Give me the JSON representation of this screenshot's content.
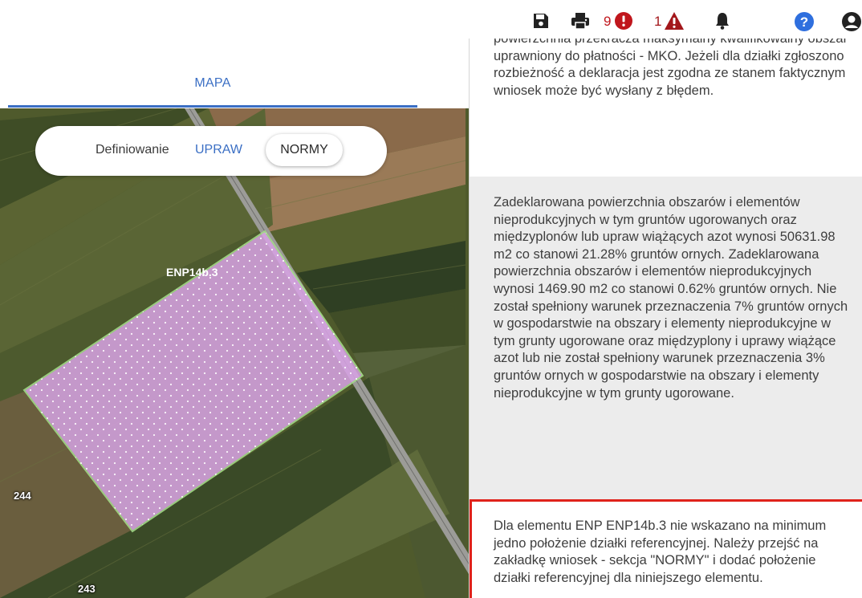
{
  "map": {
    "tab_label": "MAPA",
    "definition": {
      "label": "Definiowanie",
      "upraw": "UPRAW",
      "normy": "NORMY"
    },
    "parcel_label": "ENP14b.3",
    "parcel_numbers": [
      "244",
      "243"
    ]
  },
  "toolbar": {
    "icons": [
      "save-icon",
      "print-icon",
      "error-icon",
      "warning-icon",
      "bell-icon",
      "help-icon",
      "user-icon"
    ],
    "error_count": "9",
    "warning_count": "1"
  },
  "messages": [
    {
      "text": "powierzchnia przekracza maksymalny kwalifikowalny obszar uprawniony do płatności - MKO. Jeżeli dla działki zgłoszono rozbieżność a deklaracja jest zgodna ze stanem faktycznym wniosek może być wysłany z błędem."
    },
    {
      "text": "Zadeklarowana powierzchnia obszarów i elementów nieprodukcyjnych w tym gruntów ugorowanych oraz międzyplonów lub upraw wiążących azot wynosi 50631.98 m2 co stanowi 21.28% gruntów ornych. Zadeklarowana powierzchnia obszarów i elementów nieprodukcyjnych wynosi 1469.90 m2 co stanowi 0.62% gruntów ornych. Nie został spełniony warunek przeznaczenia 7% gruntów ornych w gospodarstwie na obszary i elementy nieprodukcyjne w tym grunty ugorowane oraz międzyplony i uprawy wiążące azot lub nie został spełniony warunek przeznaczenia 3% gruntów ornych w gospodarstwie na obszary i elementy nieprodukcyjne w tym grunty ugorowane."
    },
    {
      "text": "Dla elementu ENP ENP14b.3 nie wskazano na minimum jedno położenie działki referencyjnej. Należy przejść na zakładkę wniosek - sekcja \"NORMY\" i dodać położenie działki referencyjnej dla niniejszego elementu."
    }
  ],
  "colors": {
    "accent": "#3b6fc4",
    "error": "#c0161c",
    "warning": "#a3171b",
    "selected_border": "#e0221b",
    "parcel_fill": "#d9a3e6",
    "toolbar_icon": "#222222",
    "help_icon": "#2f6fde"
  }
}
